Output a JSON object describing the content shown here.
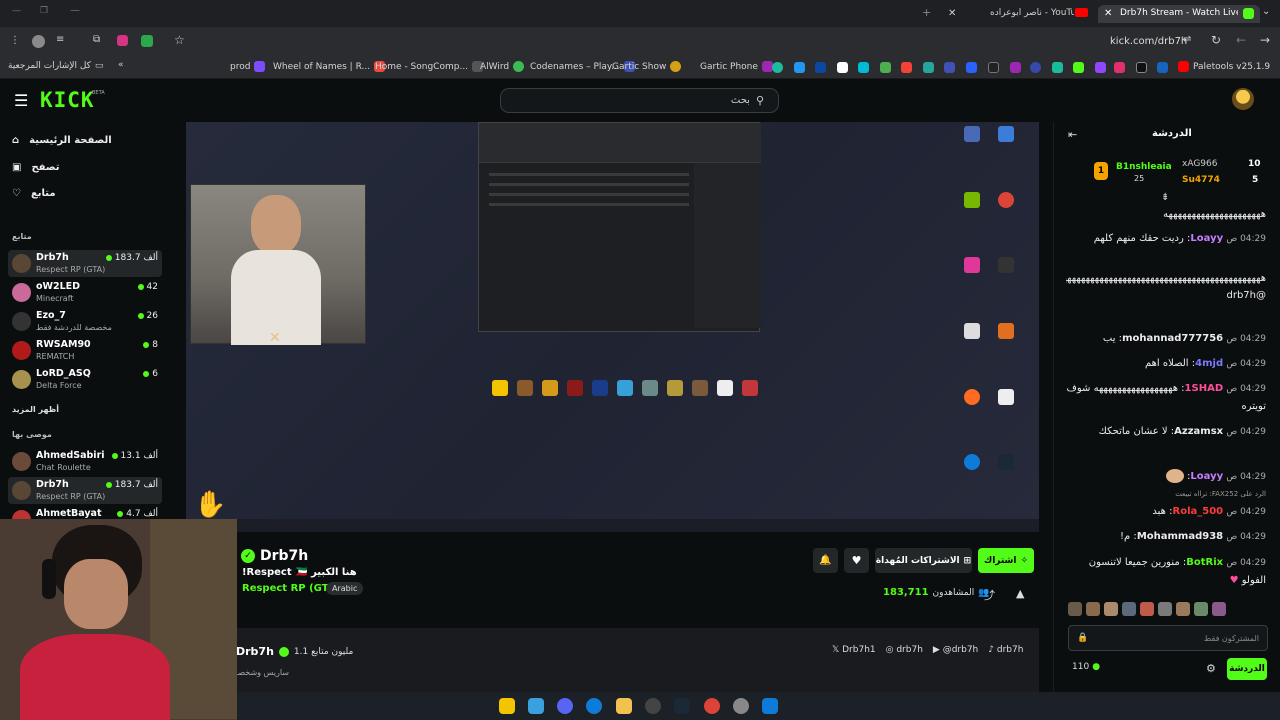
{
  "tabs": [
    {
      "label": "Drb7h Stream - Watch Live on",
      "active": true
    },
    {
      "label": "ناصر أبوعراده - YouTube",
      "active": false
    }
  ],
  "toolbar": {
    "url": "kick.com/drb7h"
  },
  "bookmarks": {
    "all_label": "كل الإشارات المرجعية",
    "items": [
      "prod",
      "Wheel of Names | R...",
      "Home - SongComp...",
      "AlWird",
      "Codenames – Play...",
      "Gartic Show",
      "Gartic Phone"
    ],
    "paletools": "Paletools v25.1.9"
  },
  "header": {
    "logo": "KICK",
    "beta": "BETA",
    "search_placeholder": "بحث"
  },
  "sidebar": {
    "nav": [
      "الصفحة الرئيسية",
      "تصفح",
      "متابع"
    ],
    "following_title": "متابع",
    "following": [
      {
        "name": "Drb7h",
        "category": "Respect RP (GTA)",
        "viewers": "183.7 ألف",
        "color": "#5a4634"
      },
      {
        "name": "oW2LED",
        "category": "Minecraft",
        "viewers": "42",
        "color": "#c96a9a"
      },
      {
        "name": "Ezo_7",
        "category": "مخصصة للدردشة فقط",
        "viewers": "26",
        "color": "#333"
      },
      {
        "name": "RWSAM90",
        "category": "REMATCH",
        "viewers": "8",
        "color": "#b01a1a"
      },
      {
        "name": "LoRD_ASQ",
        "category": "Delta Force",
        "viewers": "6",
        "color": "#a8914c"
      }
    ],
    "show_more": "أظهر المزيد",
    "recommended_title": "موصى بها",
    "recommended": [
      {
        "name": "AhmedSabiri",
        "category": "Chat Roulette",
        "viewers": "13.1 ألف",
        "color": "#6b4a3a"
      },
      {
        "name": "Drb7h",
        "category": "Respect RP (GTA)",
        "viewers": "183.7 ألف",
        "color": "#5a4634"
      },
      {
        "name": "AhmetBayat",
        "category": "",
        "viewers": "4.7 ألف",
        "color": "#b33"
      }
    ]
  },
  "stream": {
    "channel": "Drb7h",
    "title": "!Respect 🇰🇼 هنا الكبير",
    "category": "Respect RP (GTA)",
    "language": "Arabic",
    "subscribe": "اشتراك",
    "gift_subs": "الاشتراكات المُهداة",
    "viewers_label": "المشاهدون",
    "viewers": "183,711",
    "about_name": "Drb7h",
    "followers": "1.1 مليون متابع",
    "bio": "ساريس وشخصـ",
    "socials": [
      "Drb7h1",
      "drb7h",
      "@drb7h",
      "drb7h"
    ]
  },
  "chat": {
    "title": "الدردشة",
    "leaderboard": [
      {
        "name": "B1nshleaia",
        "score": "25",
        "rank": "1"
      },
      {
        "name": "xAG966",
        "score": "10"
      },
      {
        "name": "Su4774",
        "score": "5"
      }
    ],
    "messages": [
      {
        "user": "",
        "time": "",
        "text": "هههههههههههههههههههههه"
      },
      {
        "user": "Loayy",
        "time": "04:29 ص",
        "text": "رديت حقك منهم كلهم",
        "color": "#c77dff"
      },
      {
        "user": "",
        "time": "",
        "text": "ههههههههههههههههههههههههههههههههههههههههههههههههههههه @drb7h"
      },
      {
        "user": "mohannad777756",
        "time": "04:29 ص",
        "text": "يب",
        "color": "#e0e0e0"
      },
      {
        "user": "4mjd",
        "time": "04:29 ص",
        "text": "الصلاه اهم",
        "color": "#7a7aff"
      },
      {
        "user": "1SHAD",
        "time": "04:29 ص",
        "text": "هههههههههههههههههه شوف تويتره",
        "color": "#ff4f9b"
      },
      {
        "user": "Azzamsx",
        "time": "04:29 ص",
        "text": "لا عشان ماتحكك",
        "color": "#e0e0e0"
      },
      {
        "user": "Loayy",
        "time": "04:29 ص",
        "text": "",
        "color": "#c77dff"
      },
      {
        "user": "Rola_500",
        "time": "04:29 ص",
        "text": "هبد",
        "color": "#ff3b3b",
        "reply": "الرد على FAX252: ترااه تبيعت"
      },
      {
        "user": "Mohammad938",
        "time": "04:29 ص",
        "text": "م!",
        "color": "#e0e0e0"
      },
      {
        "user": "BotRix",
        "time": "04:29 ص",
        "text": "منورين جميعا لاتنسون الفولو",
        "color": "#53fc18"
      }
    ],
    "input_placeholder": "المشتركون فقط",
    "send": "الدردشة",
    "points": "110"
  },
  "colors": {
    "accent": "#53fc18",
    "bg": "#0b0e0f"
  }
}
